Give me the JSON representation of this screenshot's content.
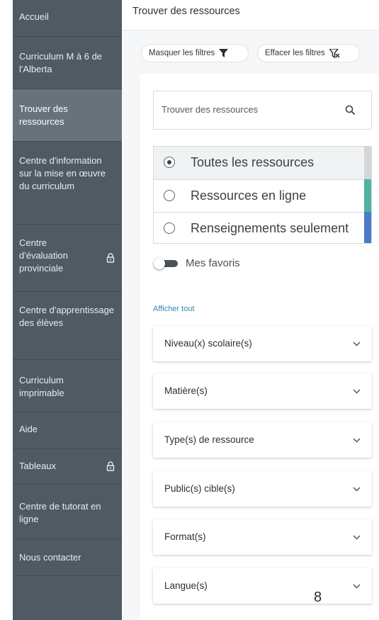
{
  "sidebar": {
    "items": [
      {
        "label": "Accueil"
      },
      {
        "label": "Curriculum M à 6 de l'Alberta"
      },
      {
        "label": "Trouver des ressources"
      },
      {
        "label": "Centre d'information sur la mise en œuvre du curriculum"
      },
      {
        "label": "Centre d'évaluation provinciale"
      },
      {
        "label": "Centre d'apprentissage des élèves"
      },
      {
        "label": "Curriculum imprimable"
      },
      {
        "label": "Aide"
      },
      {
        "label": "Tableaux"
      },
      {
        "label": "Centre de tutorat en ligne"
      },
      {
        "label": "Nous contacter"
      }
    ]
  },
  "header": {
    "title": "Trouver des ressources"
  },
  "toolbar": {
    "hide_filters": "Masquer les filtres",
    "clear_filters": "Effacer les filtres"
  },
  "search": {
    "placeholder": "Trouver des ressources"
  },
  "resource_type": {
    "options": [
      {
        "label": "Toutes les ressources"
      },
      {
        "label": "Ressources en ligne"
      },
      {
        "label": "Renseignements seulement"
      }
    ],
    "selected": "Toutes les ressources"
  },
  "favorites": {
    "label": "Mes favoris",
    "enabled": false
  },
  "filters": {
    "show_all": "Afficher tout",
    "sections": [
      {
        "label": "Niveau(x) scolaire(s)"
      },
      {
        "label": "Matière(s)"
      },
      {
        "label": "Type(s) de ressource"
      },
      {
        "label": "Public(s) cible(s)"
      },
      {
        "label": "Format(s)"
      },
      {
        "label": "Langue(s)"
      }
    ]
  },
  "overlay_number": "8",
  "colors": {
    "sidebar": "#4f5a62",
    "active": "#67727a",
    "online": "#4fb3a0",
    "info_only": "#4c78c8",
    "all": "#d4d6d8",
    "link": "#2a8ab0"
  }
}
